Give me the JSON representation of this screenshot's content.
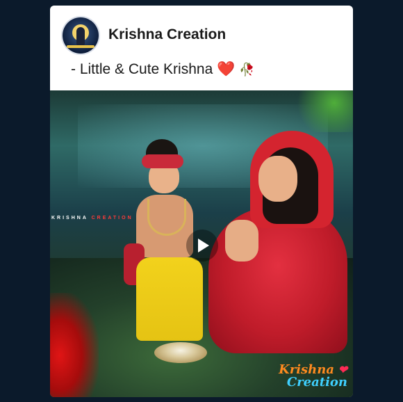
{
  "post": {
    "page_name": "Krishna Creation",
    "caption": "- Little & Cute Krishna",
    "caption_emojis": [
      "❤️",
      "🥀"
    ]
  },
  "media": {
    "type": "video",
    "watermark_left": "KRISHNA",
    "watermark_right": "CREATION",
    "logo_line1": "Krishna",
    "logo_line2": "Creation",
    "logo_heart": "❤"
  },
  "colors": {
    "background": "#0b1a2b",
    "card": "#ffffff",
    "heart": "#e02020"
  }
}
